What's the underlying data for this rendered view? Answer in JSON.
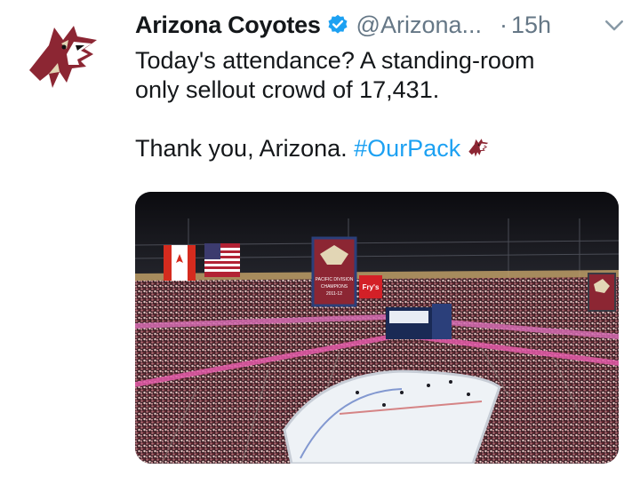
{
  "tweet": {
    "author_name": "Arizona Coyotes",
    "handle": "@Arizona...",
    "separator": "·",
    "time": "15h",
    "text_line1": "Today's attendance? A standing-room",
    "text_line2": "only sellout crowd of 17,431.",
    "text_line3": "Thank you, Arizona.",
    "hashtag": "#OurPack",
    "hashtag_color": "#1da1f2",
    "verified_color": "#1da1f2",
    "icons": {
      "avatar": "coyote-logo-icon",
      "verified": "verified-badge-icon",
      "menu": "chevron-down-icon",
      "emoji": "coyote-emoji-icon"
    },
    "media": {
      "banner_text": "PACIFIC DIVISION CHAMPIONS 2011-12",
      "sign_text": "Fry's"
    }
  }
}
